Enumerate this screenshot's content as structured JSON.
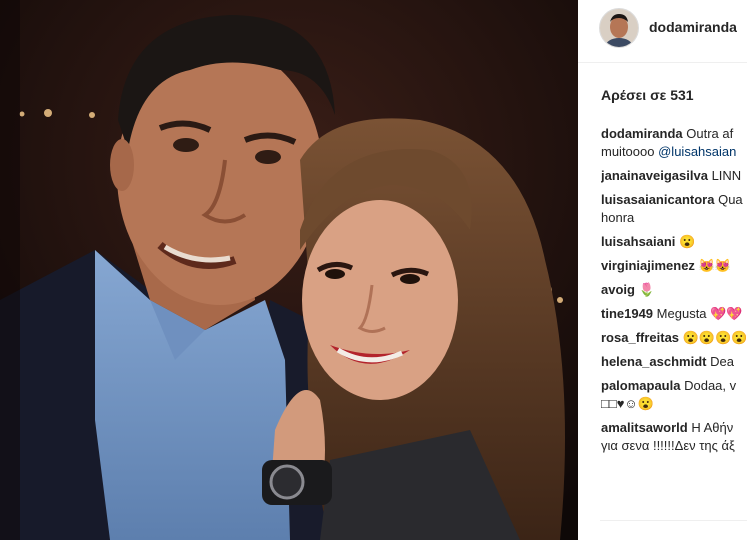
{
  "post": {
    "author": "dodamiranda",
    "likes_text": "Αρέσει σε 531",
    "comments": [
      {
        "user": "dodamiranda",
        "lines": [
          "Outra af",
          "muitoooo"
        ],
        "mention": "@luisahsaian"
      },
      {
        "user": "janainaveigasilva",
        "lines": [
          "LINN"
        ]
      },
      {
        "user": "luisasaianicantora",
        "lines": [
          "Qua",
          "honra"
        ]
      },
      {
        "user": "luisahsaiani",
        "lines": [
          "😮"
        ]
      },
      {
        "user": "virginiajimenez",
        "lines": [
          "😻😻"
        ]
      },
      {
        "user": "avoig",
        "lines": [
          "🌷"
        ]
      },
      {
        "user": "tine1949",
        "lines": [
          "Megusta 💖💖"
        ]
      },
      {
        "user": "rosa_ffreitas",
        "lines": [
          "😮😮😮😮"
        ]
      },
      {
        "user": "helena_aschmidt",
        "lines": [
          "Dea"
        ]
      },
      {
        "user": "palomapaula",
        "lines": [
          "Dodaa, v",
          "□□♥☺😮"
        ]
      },
      {
        "user": "amalitsaworld",
        "lines": [
          "Η Αθήν",
          "για σενα !!!!!!Δεν της άξ"
        ]
      }
    ]
  },
  "colors": {
    "text": "#262626",
    "link": "#003569",
    "border": "#efefef"
  },
  "icons": {
    "avatar": "profile-avatar-icon"
  }
}
